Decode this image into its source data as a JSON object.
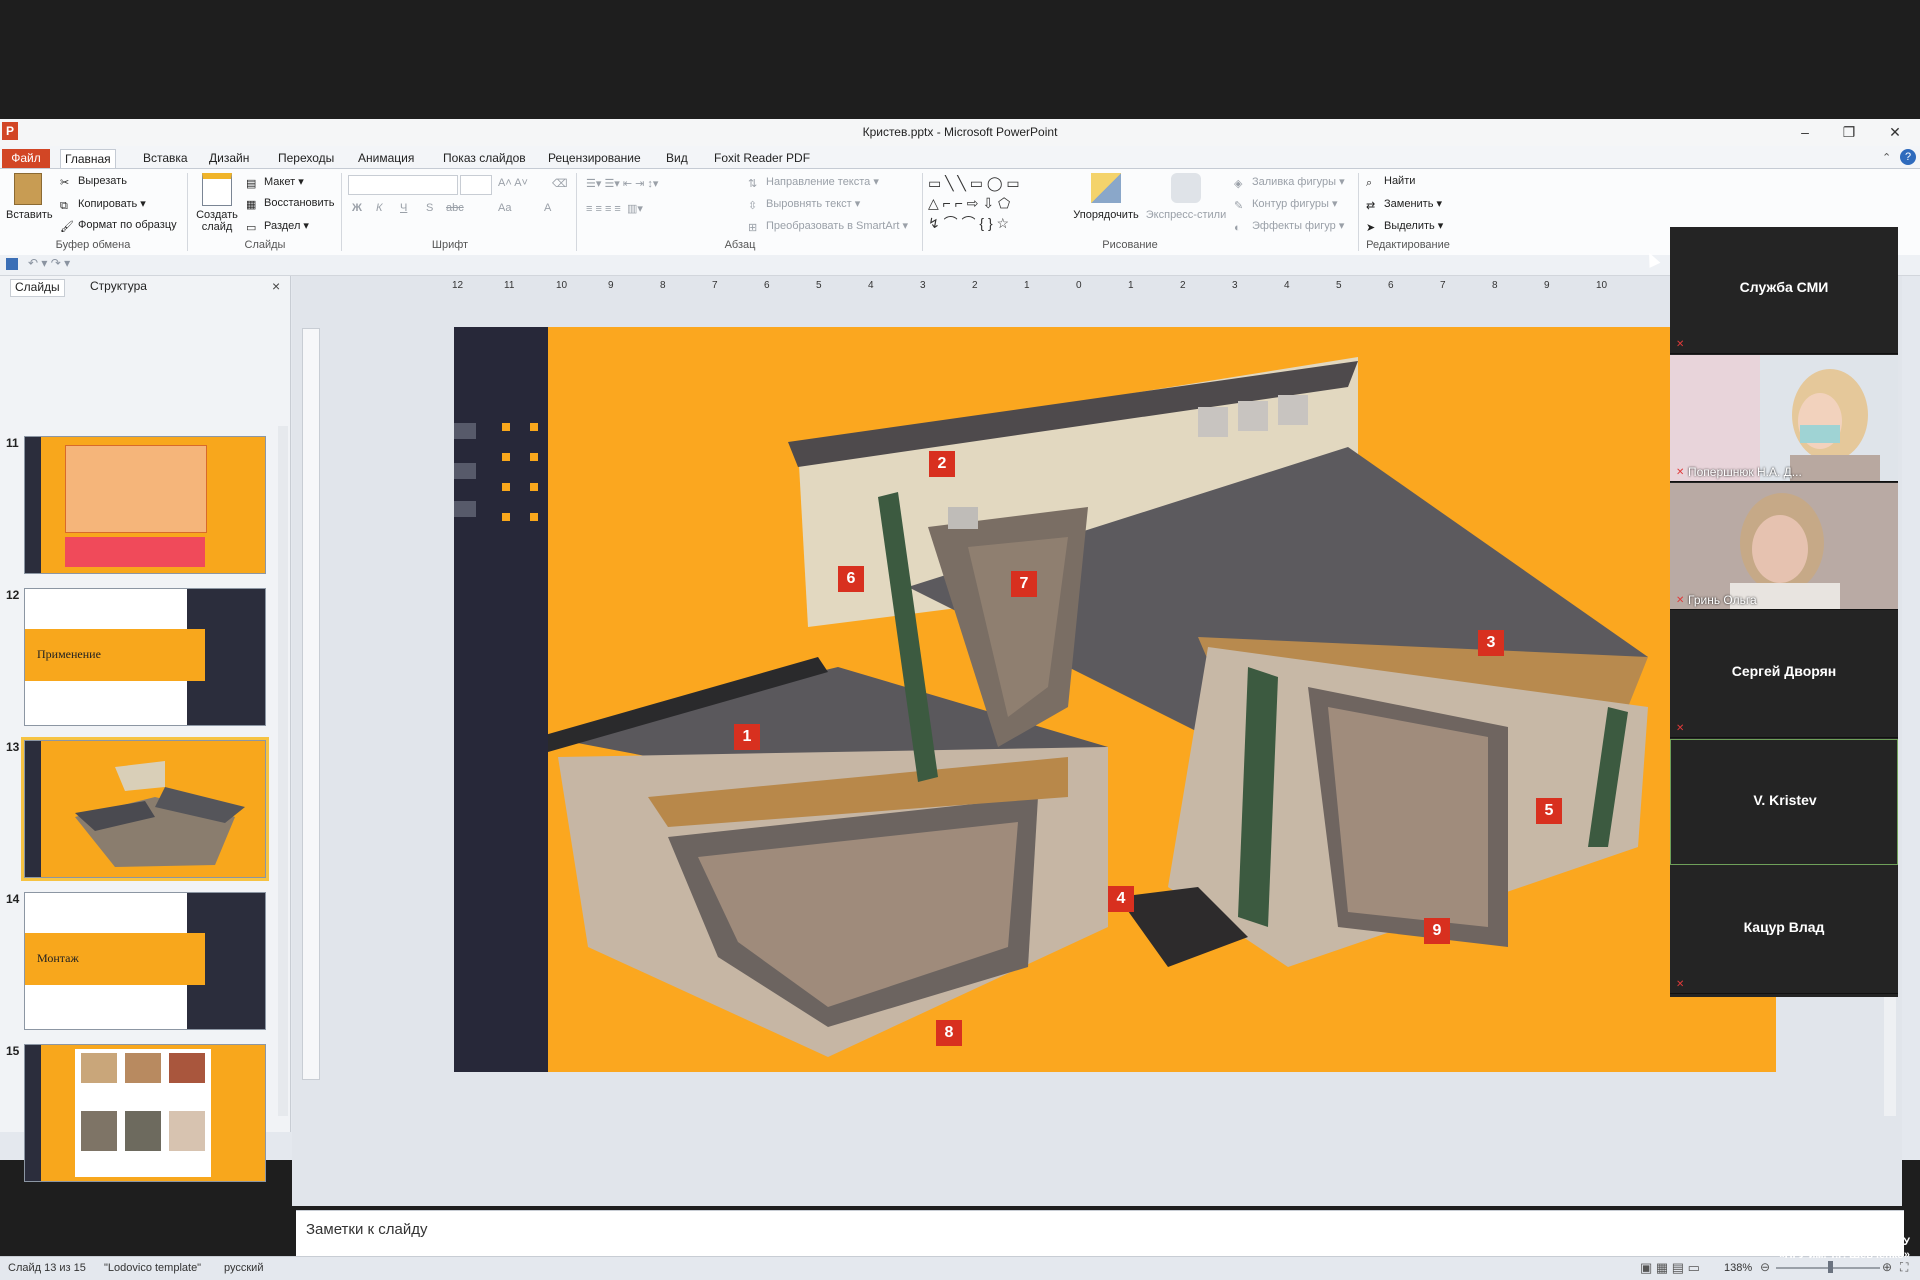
{
  "window": {
    "title": "Кристев.pptx  -  Microsoft PowerPoint",
    "app_icon": "P"
  },
  "tabs": {
    "file": "Файл",
    "items": [
      "Главная",
      "Вставка",
      "Дизайн",
      "Переходы",
      "Анимация",
      "Показ слайдов",
      "Рецензирование",
      "Вид",
      "Foxit Reader PDF"
    ],
    "active": "Главная"
  },
  "ribbon": {
    "clipboard": {
      "paste": "Вставить",
      "cut": "Вырезать",
      "copy": "Копировать",
      "format_painter": "Формат по образцу",
      "group": "Буфер обмена"
    },
    "slides": {
      "new_slide_1": "Создать",
      "new_slide_2": "слайд",
      "layout": "Макет",
      "reset": "Восстановить",
      "section": "Раздел",
      "group": "Слайды"
    },
    "font": {
      "group": "Шрифт",
      "bold": "Ж",
      "italic": "К",
      "underline": "Ч",
      "strike": "S",
      "spacing": "abc",
      "case": "Aa",
      "color": "A"
    },
    "paragraph": {
      "text_direction": "Направление текста",
      "align_text": "Выровнять текст",
      "convert_smartart": "Преобразовать в SmartArt",
      "group": "Абзац"
    },
    "drawing": {
      "arrange": "Упорядочить",
      "quick_styles": "Экспресс-стили",
      "fill": "Заливка фигуры",
      "outline": "Контур фигуры",
      "effects": "Эффекты фигур",
      "group": "Рисование"
    },
    "editing": {
      "find": "Найти",
      "replace": "Заменить",
      "select": "Выделить",
      "group": "Редактирование"
    }
  },
  "left_panel": {
    "tab_slides": "Слайды",
    "tab_outline": "Структура",
    "close": "×",
    "thumbnails": [
      {
        "num": "11"
      },
      {
        "num": "12",
        "title": "Применение"
      },
      {
        "num": "13"
      },
      {
        "num": "14",
        "title": "Монтаж"
      },
      {
        "num": "15"
      }
    ]
  },
  "ruler": {
    "h_labels": [
      "12",
      "11",
      "10",
      "9",
      "8",
      "7",
      "6",
      "5",
      "4",
      "3",
      "2",
      "1",
      "0",
      "1",
      "2",
      "3",
      "4",
      "5",
      "6",
      "7",
      "8",
      "9",
      "10"
    ]
  },
  "slide": {
    "labels": [
      "1",
      "2",
      "3",
      "4",
      "5",
      "6",
      "7",
      "8",
      "9"
    ]
  },
  "notes": {
    "placeholder": "Заметки к слайду"
  },
  "status": {
    "slide_info": "Слайд 13 из 15",
    "theme": "\"Lodovico template\"",
    "language": "русский",
    "zoom": "138%"
  },
  "participants": [
    {
      "name": "Служба СМИ",
      "video": false
    },
    {
      "name": "Попершнюк Н.А. Д...",
      "video": true
    },
    {
      "name": "Гринь Ольга",
      "video": true
    },
    {
      "name": "Сергей Дворян",
      "video": false
    },
    {
      "name": "V. Kristev",
      "video": false,
      "active": true
    },
    {
      "name": "Кацур Влад",
      "video": false
    }
  ],
  "brand": {
    "line1": "БПФ ГОУ",
    "line2": "«ПГУ им. Т.Г. Шевченко»"
  }
}
